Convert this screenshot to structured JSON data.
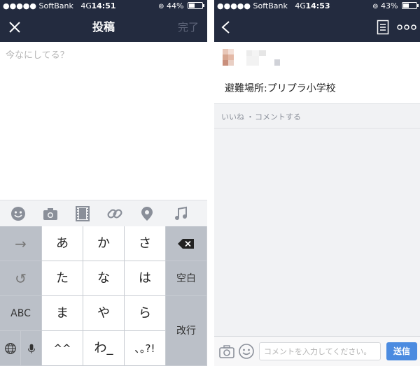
{
  "left_screen": {
    "status": {
      "carrier": "●●●●● SoftBank",
      "network": "4G",
      "time": "14:51",
      "battery": "44%",
      "battery_level": 0.44
    },
    "nav": {
      "title": "投稿",
      "done": "完了"
    },
    "compose_placeholder": "今なにしてる？",
    "keyboard": {
      "arrow": "→",
      "undo": "↺",
      "abc": "ABC",
      "delete_label": "⌫",
      "space": "空白",
      "enter": "改行",
      "rows": [
        [
          "あ",
          "か",
          "さ"
        ],
        [
          "た",
          "な",
          "は"
        ],
        [
          "ま",
          "や",
          "ら"
        ],
        [
          "^^",
          "わ_",
          "､｡?!"
        ]
      ]
    },
    "icons": [
      "smiley-icon",
      "camera-icon",
      "film-icon",
      "link-icon",
      "location-pin-icon",
      "music-note-icon",
      "globe-icon",
      "microphone-icon",
      "close-icon",
      "backspace-icon"
    ]
  },
  "right_screen": {
    "status": {
      "carrier": "●●●●● SoftBank",
      "network": "4G",
      "time": "14:53",
      "battery": "43%",
      "battery_level": 0.43
    },
    "post_text": "避難場所:プリプラ小学校",
    "actions": {
      "like": "いいね",
      "separator": "・",
      "comment": "コメントする"
    },
    "comment_placeholder": "コメントを入力してください。",
    "send": "送信",
    "colors": {
      "navbar": "#232b3f",
      "send_button": "#4b8be0"
    }
  }
}
